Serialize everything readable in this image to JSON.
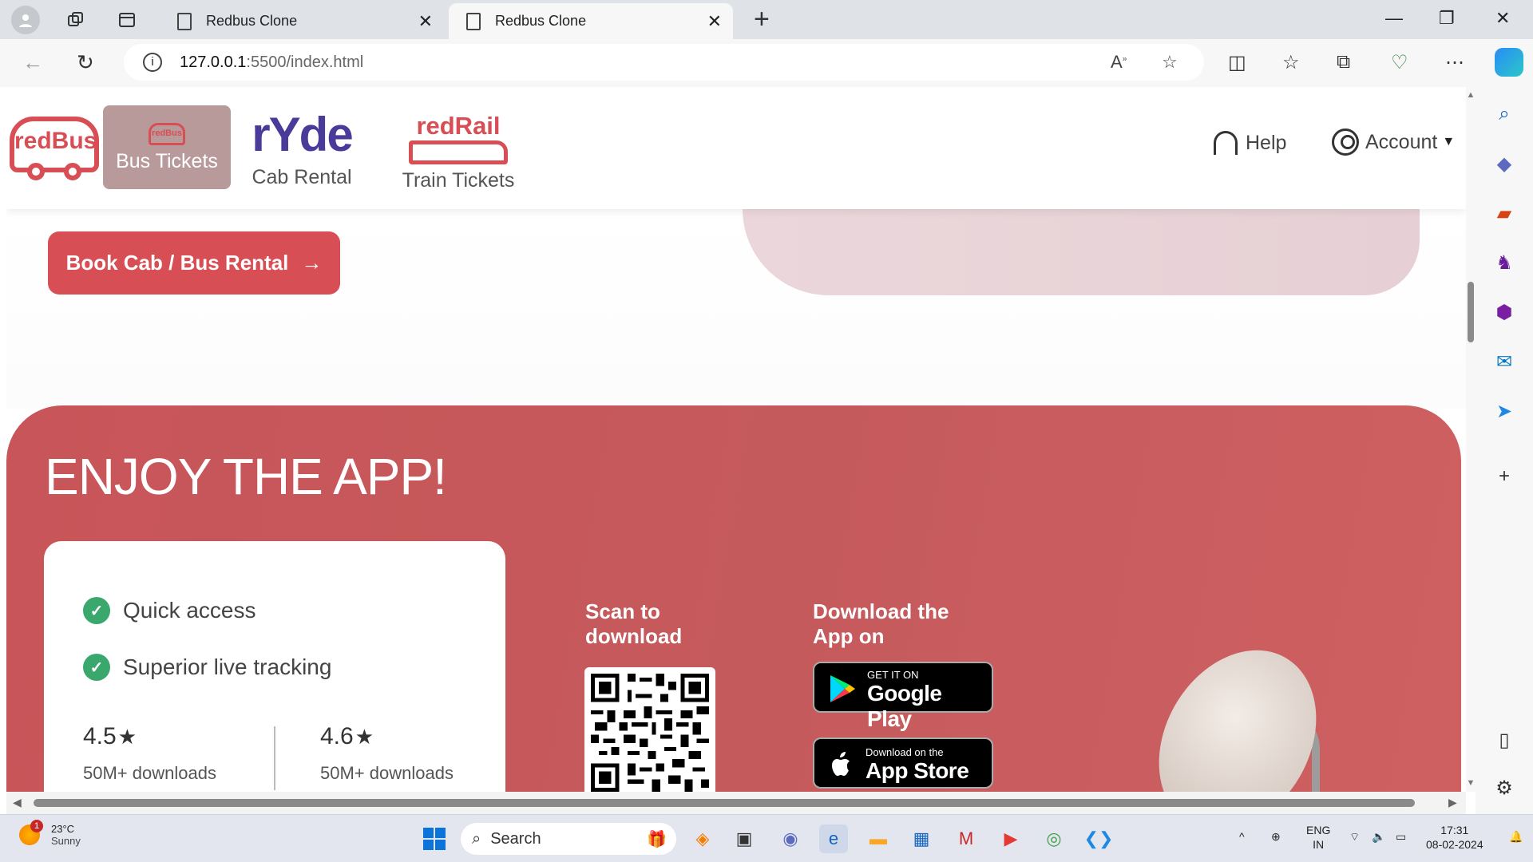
{
  "browser": {
    "tabs": [
      {
        "title": "Redbus Clone",
        "active": false
      },
      {
        "title": "Redbus Clone",
        "active": true
      }
    ],
    "url_host": "127.0.0.1",
    "url_path": ":5500/index.html"
  },
  "header": {
    "logo": "redBus",
    "nav": [
      {
        "label": "Bus Tickets",
        "mark": "redBus",
        "active": true
      },
      {
        "label": "Cab Rental",
        "mark": "rYde",
        "active": false
      },
      {
        "label": "Train Tickets",
        "mark": "redRail",
        "active": false
      }
    ],
    "help_label": "Help",
    "account_label": "Account"
  },
  "hero": {
    "cta_label": "Book Cab / Bus Rental"
  },
  "app_section": {
    "title": "ENJOY THE APP!",
    "features": [
      "Quick access",
      "Superior live tracking"
    ],
    "ratings": [
      {
        "value": "4.5",
        "downloads": "50M+ downloads"
      },
      {
        "value": "4.6",
        "downloads": "50M+ downloads"
      }
    ],
    "scan_label": "Scan to download",
    "download_label": "Download the App on",
    "google_play": {
      "small": "GET IT ON",
      "big": "Google Play"
    },
    "app_store": {
      "small": "Download on the",
      "big": "App Store"
    }
  },
  "taskbar": {
    "weather_temp": "23°C",
    "weather_desc": "Sunny",
    "weather_badge": "1",
    "search_placeholder": "Search",
    "lang_1": "ENG",
    "lang_2": "IN",
    "time": "17:31",
    "date": "08-02-2024"
  },
  "colors": {
    "brand_red": "#d84e55",
    "app_section_bg": "#c85559",
    "bus_tab_bg": "#b89a9a",
    "ryde_purple": "#4a3a9a",
    "check_green": "#3aa76d"
  }
}
